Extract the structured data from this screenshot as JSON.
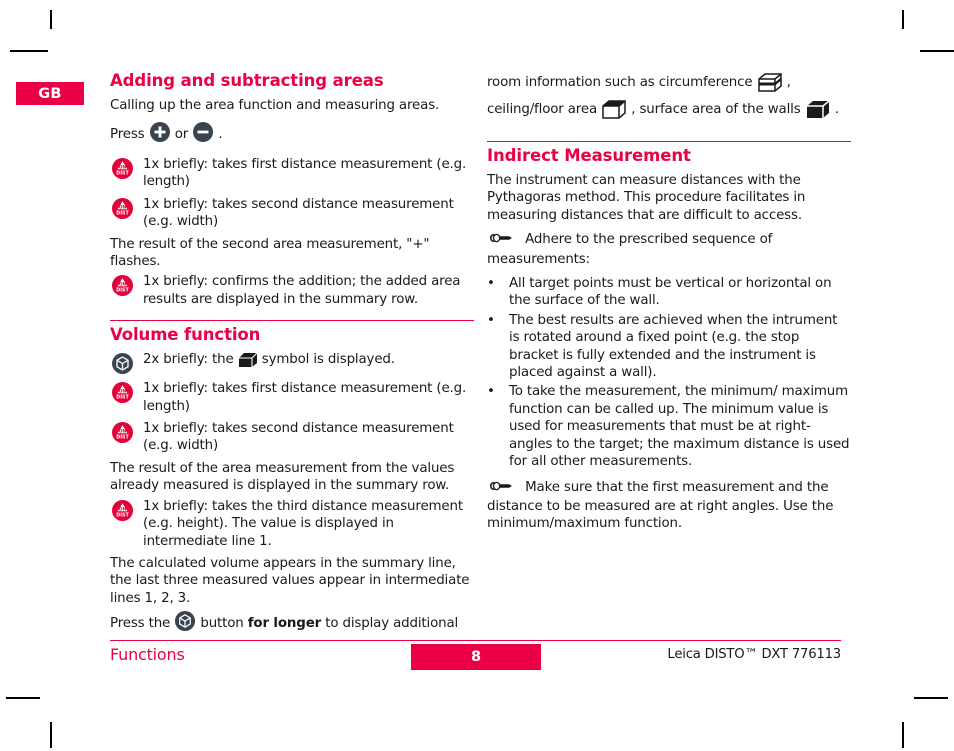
{
  "page": {
    "language_tab": "GB",
    "footer_section": "Functions",
    "page_number": "8",
    "footer_product": "Leica DISTO™ DXT 776113",
    "brand_color": "#ec0045"
  },
  "left_column": {
    "heading": "Adding and subtracting areas",
    "intro": "Calling up the area function and measuring areas.",
    "press_prefix": "Press",
    "press_or": "or",
    "press_suffix": ".",
    "steps": [
      {
        "icon": "on-dist-button-icon",
        "text": "1x briefly: takes first distance measurement (e.g. length)"
      },
      {
        "icon": "on-dist-button-icon",
        "text": "1x briefly: takes second distance measurement (e.g. width)"
      }
    ],
    "result_note": "The result of the second area measurement, \"+\" flashes.",
    "confirm_step": {
      "icon": "on-dist-button-icon",
      "text": "1x briefly: confirms the addition; the added area results are displayed in the summary row."
    },
    "volume_heading": "Volume function",
    "volume_steps": [
      {
        "icon": "volume-button-icon",
        "text_before": "2x briefly: the",
        "symbol": "volume-cube-symbol",
        "text_after": "symbol is displayed."
      },
      {
        "icon": "on-dist-button-icon",
        "text": "1x briefly: takes first distance measurement (e.g. length)"
      },
      {
        "icon": "on-dist-button-icon",
        "text": "1x briefly: takes second distance measurement (e.g. width)"
      }
    ],
    "area_result_note": "The result of the area measurement from the values already measured is displayed in the summary row.",
    "third_step": {
      "icon": "on-dist-button-icon",
      "text": "1x briefly: takes the third distance measurement (e.g. height). The value is displayed in intermediate line 1."
    },
    "volume_result_note": "The calculated volume appears in the summary line, the last three measured values appear in intermediate lines 1, 2, 3.",
    "press_longer": {
      "prefix": "Press the",
      "icon": "volume-button-icon",
      "middle": "button",
      "bold": "for longer",
      "suffix": "to display additional"
    }
  },
  "right_column": {
    "continuation": {
      "text_1": "room information such as circumference",
      "symbol_1": "circumference-cube-symbol",
      "text_2": ", ceiling/floor area",
      "symbol_2": "ceiling-floor-cube-symbol",
      "text_3": ", surface area of the walls",
      "symbol_3": "walls-cube-symbol",
      "text_4": "."
    },
    "heading": "Indirect Measurement",
    "intro": "The instrument can measure distances with the Pythagoras method. This procedure facilitates in measuring distances that are difficult to access.",
    "note_1": {
      "icon": "pointing-hand-icon",
      "text": "Adhere to the prescribed sequence of measurements:"
    },
    "bullets": [
      "All target points must be vertical or horizontal on the surface of the wall.",
      "The best results are achieved when the intrument is rotated around a fixed point (e.g. the stop bracket is fully extended and the instrument is placed against a wall).",
      "To take the measurement, the minimum/ maximum function can be called up. The minimum value is used for measurements that must be at right-angles to the target; the maximum distance is used for all other measurements."
    ],
    "bullet_char": "•",
    "note_2": {
      "icon": "pointing-hand-icon",
      "text": "Make sure that the first measurement and the distance to be measured are at right angles. Use the minimum/maximum function."
    }
  }
}
